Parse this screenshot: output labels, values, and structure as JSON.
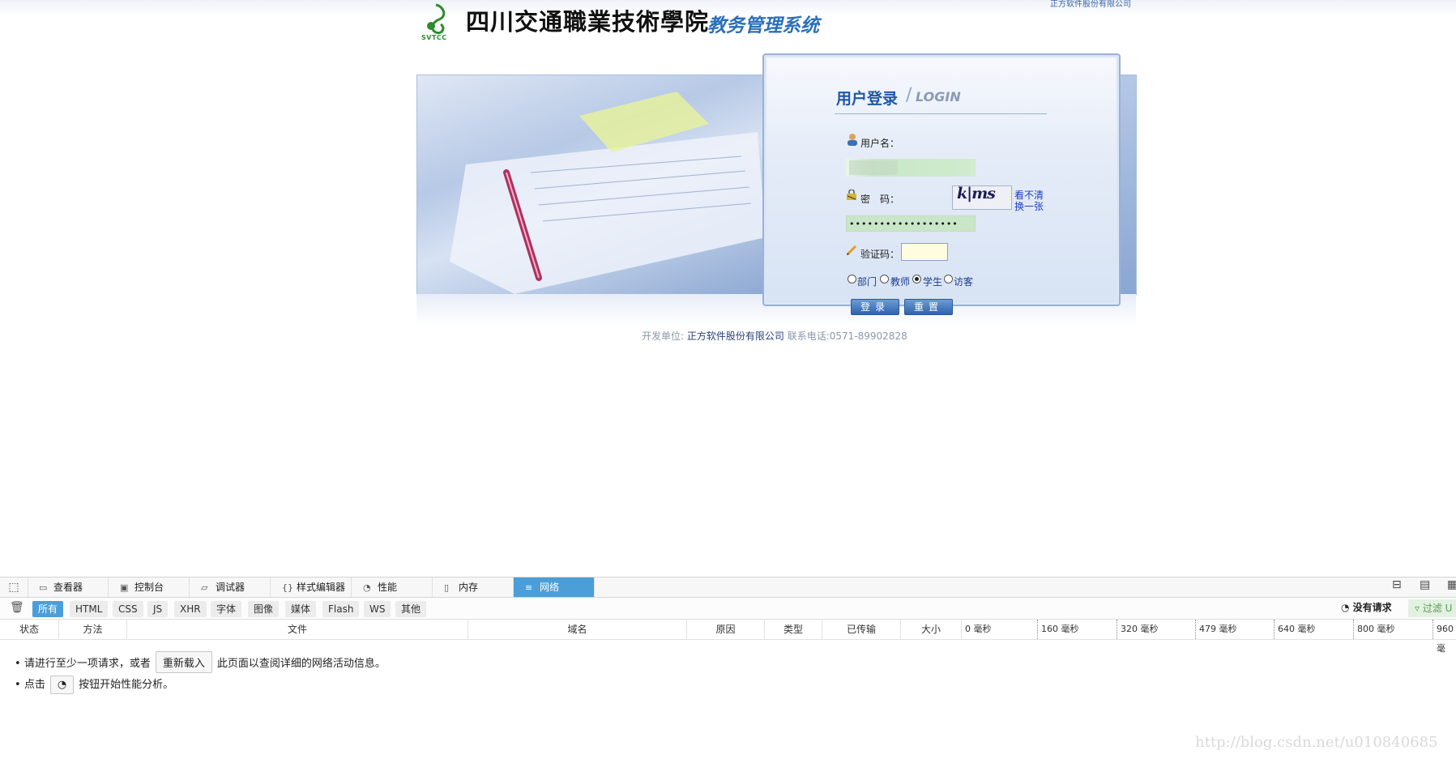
{
  "header": {
    "company_top": "正方软件股份有限公司",
    "logo_text": "SVTCC",
    "school_name": "四川交通職業技術學院",
    "system_name": "教务管理系统"
  },
  "login": {
    "title": "用户登录",
    "title_en": "LOGIN",
    "username_label": "用户名：",
    "username_value": "",
    "password_label": "密　码：",
    "password_value": "••••••••••••••••••",
    "captcha_text": "k|ms",
    "refresh_line1": "看不清",
    "refresh_line2": "换一张",
    "code_label": "验证码：",
    "code_value": "",
    "roles": [
      "部门",
      "教师",
      "学生",
      "访客"
    ],
    "selected_role": "学生",
    "login_button": "登录",
    "reset_button": "重置"
  },
  "footer": {
    "dev_label": "开发单位:",
    "dev_company": "正方软件股份有限公司",
    "phone": "联系电话:0571-89902828"
  },
  "devtools": {
    "tabs": [
      {
        "label": "查看器",
        "icon": "inspector-icon"
      },
      {
        "label": "控制台",
        "icon": "console-icon"
      },
      {
        "label": "调试器",
        "icon": "debugger-icon"
      },
      {
        "label": "样式编辑器",
        "icon": "style-editor-icon"
      },
      {
        "label": "性能",
        "icon": "performance-icon"
      },
      {
        "label": "内存",
        "icon": "memory-icon"
      },
      {
        "label": "网络",
        "icon": "network-icon"
      }
    ],
    "active_tab": "网络",
    "filters": [
      "所有",
      "HTML",
      "CSS",
      "JS",
      "XHR",
      "字体",
      "图像",
      "媒体",
      "Flash",
      "WS",
      "其他"
    ],
    "active_filter": "所有",
    "no_requests": "没有请求",
    "filter_url": "过滤 U",
    "columns": [
      "状态",
      "方法",
      "文件",
      "域名",
      "原因",
      "类型",
      "已传输",
      "大小"
    ],
    "timeline": [
      "0 毫秒",
      "160 毫秒",
      "320 毫秒",
      "479 毫秒",
      "640 毫秒",
      "800 毫秒",
      "960 毫"
    ],
    "msg1_before": "请进行至少一项请求，或者",
    "reload_button": "重新载入",
    "msg1_after": "此页面以查阅详细的网络活动信息。",
    "msg2_before": "点击",
    "msg2_after": "按钮开始性能分析。"
  },
  "watermark": "http://blog.csdn.net/u010840685"
}
